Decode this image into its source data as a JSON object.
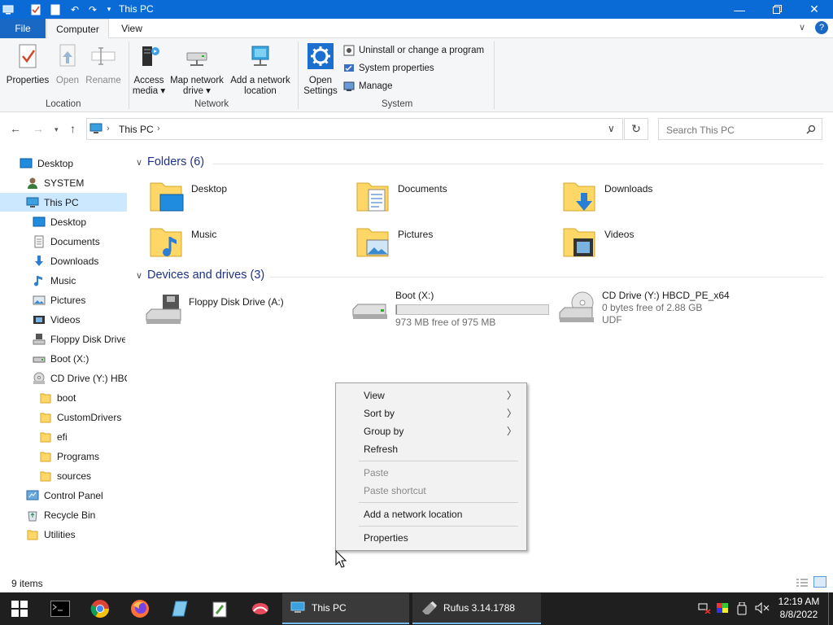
{
  "window": {
    "title": "This PC"
  },
  "tabs": {
    "file": "File",
    "computer": "Computer",
    "view": "View"
  },
  "ribbon": {
    "location": {
      "label": "Location",
      "properties": "Properties",
      "open": "Open",
      "rename": "Rename"
    },
    "network": {
      "label": "Network",
      "access_media_1": "Access",
      "access_media_2": "media ▾",
      "map_drive_1": "Map network",
      "map_drive_2": "drive ▾",
      "add_location_1": "Add a network",
      "add_location_2": "location"
    },
    "system": {
      "label": "System",
      "open_settings_1": "Open",
      "open_settings_2": "Settings",
      "uninstall": "Uninstall or change a program",
      "system_properties": "System properties",
      "manage": "Manage"
    }
  },
  "address": {
    "path": "This PC",
    "search_placeholder": "Search This PC"
  },
  "nav": [
    {
      "label": "Desktop",
      "icon": "desktop-icon"
    },
    {
      "label": "SYSTEM",
      "icon": "user-icon"
    },
    {
      "label": "This PC",
      "icon": "computer-icon"
    },
    {
      "label": "Desktop",
      "icon": "desktop-icon"
    },
    {
      "label": "Documents",
      "icon": "document-icon"
    },
    {
      "label": "Downloads",
      "icon": "download-icon"
    },
    {
      "label": "Music",
      "icon": "music-icon"
    },
    {
      "label": "Pictures",
      "icon": "pictures-icon"
    },
    {
      "label": "Videos",
      "icon": "video-icon"
    },
    {
      "label": "Floppy Disk Drive",
      "icon": "floppy-icon"
    },
    {
      "label": "Boot (X:)",
      "icon": "drive-icon"
    },
    {
      "label": "CD Drive (Y:) HBC",
      "icon": "cd-icon"
    },
    {
      "label": "boot",
      "icon": "folder-icon"
    },
    {
      "label": "CustomDrivers",
      "icon": "folder-icon"
    },
    {
      "label": "efi",
      "icon": "folder-icon"
    },
    {
      "label": "Programs",
      "icon": "folder-icon"
    },
    {
      "label": "sources",
      "icon": "folder-icon"
    },
    {
      "label": "Control Panel",
      "icon": "control-panel-icon"
    },
    {
      "label": "Recycle Bin",
      "icon": "recycle-bin-icon"
    },
    {
      "label": "Utilities",
      "icon": "folder-icon"
    }
  ],
  "folders": {
    "header": "Folders (6)",
    "items": [
      "Desktop",
      "Documents",
      "Downloads",
      "Music",
      "Pictures",
      "Videos"
    ]
  },
  "drives": {
    "header": "Devices and drives (3)",
    "floppy": {
      "name": "Floppy Disk Drive (A:)"
    },
    "boot": {
      "name": "Boot (X:)",
      "free": "973 MB free of 975 MB",
      "used_fraction": 0.002
    },
    "cd": {
      "name": "CD Drive (Y:) HBCD_PE_x64",
      "free": "0 bytes free of 2.88 GB",
      "fs": "UDF"
    }
  },
  "context_menu": {
    "view": "View",
    "sort_by": "Sort by",
    "group_by": "Group by",
    "refresh": "Refresh",
    "paste": "Paste",
    "paste_shortcut": "Paste shortcut",
    "add_network_location": "Add a network location",
    "properties": "Properties"
  },
  "status": {
    "items": "9 items"
  },
  "taskbar": {
    "app1": "This PC",
    "app2": "Rufus 3.14.1788",
    "time": "12:19 AM",
    "date": "8/8/2022"
  },
  "colors": {
    "titlebar": "#0a6bd6",
    "accent": "#26a0da",
    "selection": "#cce8ff"
  }
}
